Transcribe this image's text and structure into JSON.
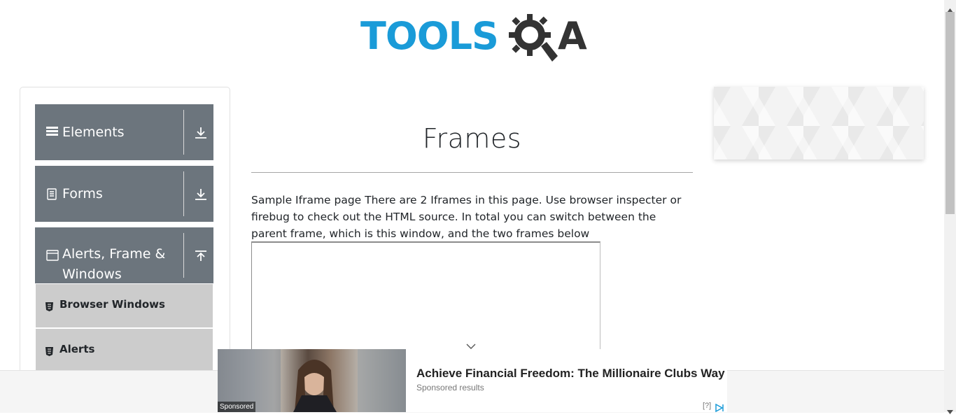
{
  "logo": {
    "tools": "TOOLS",
    "a": "A"
  },
  "sidebar": {
    "groups": [
      {
        "label": "Elements",
        "icon": "hamburger-icon",
        "toggle": "download-arrow-icon"
      },
      {
        "label": "Forms",
        "icon": "document-icon",
        "toggle": "download-arrow-icon"
      },
      {
        "label": "Alerts, Frame & Windows",
        "icon": "window-icon",
        "toggle": "upload-arrow-icon"
      }
    ],
    "items": [
      {
        "label": "Browser Windows",
        "icon": "html5-shield-icon"
      },
      {
        "label": "Alerts",
        "icon": "html5-shield-icon"
      }
    ]
  },
  "main": {
    "title": "Frames",
    "description": "Sample Iframe page There are 2 Iframes in this page. Use browser inspecter or firebug to check out the HTML source. In total you can switch between the parent frame, which is this window, and the two frames below"
  },
  "ad": {
    "sponsored_tag": "Sponsored",
    "headline": "Achieve Financial Freedom: The Millionaire Clubs Way",
    "sub": "Sponsored results",
    "info": "[?]"
  },
  "colors": {
    "brand_blue": "#1a9bd8",
    "brand_dark": "#333333",
    "group_header_bg": "#6c757d",
    "menu_item_bg": "#cccccc"
  }
}
